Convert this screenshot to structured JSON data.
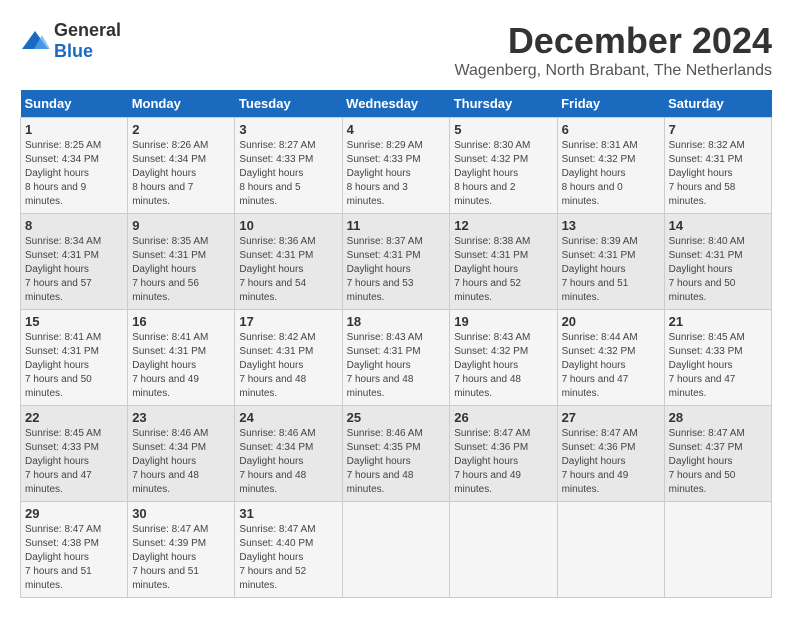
{
  "logo": {
    "general": "General",
    "blue": "Blue"
  },
  "title": "December 2024",
  "subtitle": "Wagenberg, North Brabant, The Netherlands",
  "days_header": [
    "Sunday",
    "Monday",
    "Tuesday",
    "Wednesday",
    "Thursday",
    "Friday",
    "Saturday"
  ],
  "weeks": [
    [
      {
        "day": "1",
        "sunrise": "8:25 AM",
        "sunset": "4:34 PM",
        "daylight": "8 hours and 9 minutes."
      },
      {
        "day": "2",
        "sunrise": "8:26 AM",
        "sunset": "4:34 PM",
        "daylight": "8 hours and 7 minutes."
      },
      {
        "day": "3",
        "sunrise": "8:27 AM",
        "sunset": "4:33 PM",
        "daylight": "8 hours and 5 minutes."
      },
      {
        "day": "4",
        "sunrise": "8:29 AM",
        "sunset": "4:33 PM",
        "daylight": "8 hours and 3 minutes."
      },
      {
        "day": "5",
        "sunrise": "8:30 AM",
        "sunset": "4:32 PM",
        "daylight": "8 hours and 2 minutes."
      },
      {
        "day": "6",
        "sunrise": "8:31 AM",
        "sunset": "4:32 PM",
        "daylight": "8 hours and 0 minutes."
      },
      {
        "day": "7",
        "sunrise": "8:32 AM",
        "sunset": "4:31 PM",
        "daylight": "7 hours and 58 minutes."
      }
    ],
    [
      {
        "day": "8",
        "sunrise": "8:34 AM",
        "sunset": "4:31 PM",
        "daylight": "7 hours and 57 minutes."
      },
      {
        "day": "9",
        "sunrise": "8:35 AM",
        "sunset": "4:31 PM",
        "daylight": "7 hours and 56 minutes."
      },
      {
        "day": "10",
        "sunrise": "8:36 AM",
        "sunset": "4:31 PM",
        "daylight": "7 hours and 54 minutes."
      },
      {
        "day": "11",
        "sunrise": "8:37 AM",
        "sunset": "4:31 PM",
        "daylight": "7 hours and 53 minutes."
      },
      {
        "day": "12",
        "sunrise": "8:38 AM",
        "sunset": "4:31 PM",
        "daylight": "7 hours and 52 minutes."
      },
      {
        "day": "13",
        "sunrise": "8:39 AM",
        "sunset": "4:31 PM",
        "daylight": "7 hours and 51 minutes."
      },
      {
        "day": "14",
        "sunrise": "8:40 AM",
        "sunset": "4:31 PM",
        "daylight": "7 hours and 50 minutes."
      }
    ],
    [
      {
        "day": "15",
        "sunrise": "8:41 AM",
        "sunset": "4:31 PM",
        "daylight": "7 hours and 50 minutes."
      },
      {
        "day": "16",
        "sunrise": "8:41 AM",
        "sunset": "4:31 PM",
        "daylight": "7 hours and 49 minutes."
      },
      {
        "day": "17",
        "sunrise": "8:42 AM",
        "sunset": "4:31 PM",
        "daylight": "7 hours and 48 minutes."
      },
      {
        "day": "18",
        "sunrise": "8:43 AM",
        "sunset": "4:31 PM",
        "daylight": "7 hours and 48 minutes."
      },
      {
        "day": "19",
        "sunrise": "8:43 AM",
        "sunset": "4:32 PM",
        "daylight": "7 hours and 48 minutes."
      },
      {
        "day": "20",
        "sunrise": "8:44 AM",
        "sunset": "4:32 PM",
        "daylight": "7 hours and 47 minutes."
      },
      {
        "day": "21",
        "sunrise": "8:45 AM",
        "sunset": "4:33 PM",
        "daylight": "7 hours and 47 minutes."
      }
    ],
    [
      {
        "day": "22",
        "sunrise": "8:45 AM",
        "sunset": "4:33 PM",
        "daylight": "7 hours and 47 minutes."
      },
      {
        "day": "23",
        "sunrise": "8:46 AM",
        "sunset": "4:34 PM",
        "daylight": "7 hours and 48 minutes."
      },
      {
        "day": "24",
        "sunrise": "8:46 AM",
        "sunset": "4:34 PM",
        "daylight": "7 hours and 48 minutes."
      },
      {
        "day": "25",
        "sunrise": "8:46 AM",
        "sunset": "4:35 PM",
        "daylight": "7 hours and 48 minutes."
      },
      {
        "day": "26",
        "sunrise": "8:47 AM",
        "sunset": "4:36 PM",
        "daylight": "7 hours and 49 minutes."
      },
      {
        "day": "27",
        "sunrise": "8:47 AM",
        "sunset": "4:36 PM",
        "daylight": "7 hours and 49 minutes."
      },
      {
        "day": "28",
        "sunrise": "8:47 AM",
        "sunset": "4:37 PM",
        "daylight": "7 hours and 50 minutes."
      }
    ],
    [
      {
        "day": "29",
        "sunrise": "8:47 AM",
        "sunset": "4:38 PM",
        "daylight": "7 hours and 51 minutes."
      },
      {
        "day": "30",
        "sunrise": "8:47 AM",
        "sunset": "4:39 PM",
        "daylight": "7 hours and 51 minutes."
      },
      {
        "day": "31",
        "sunrise": "8:47 AM",
        "sunset": "4:40 PM",
        "daylight": "7 hours and 52 minutes."
      },
      null,
      null,
      null,
      null
    ]
  ]
}
